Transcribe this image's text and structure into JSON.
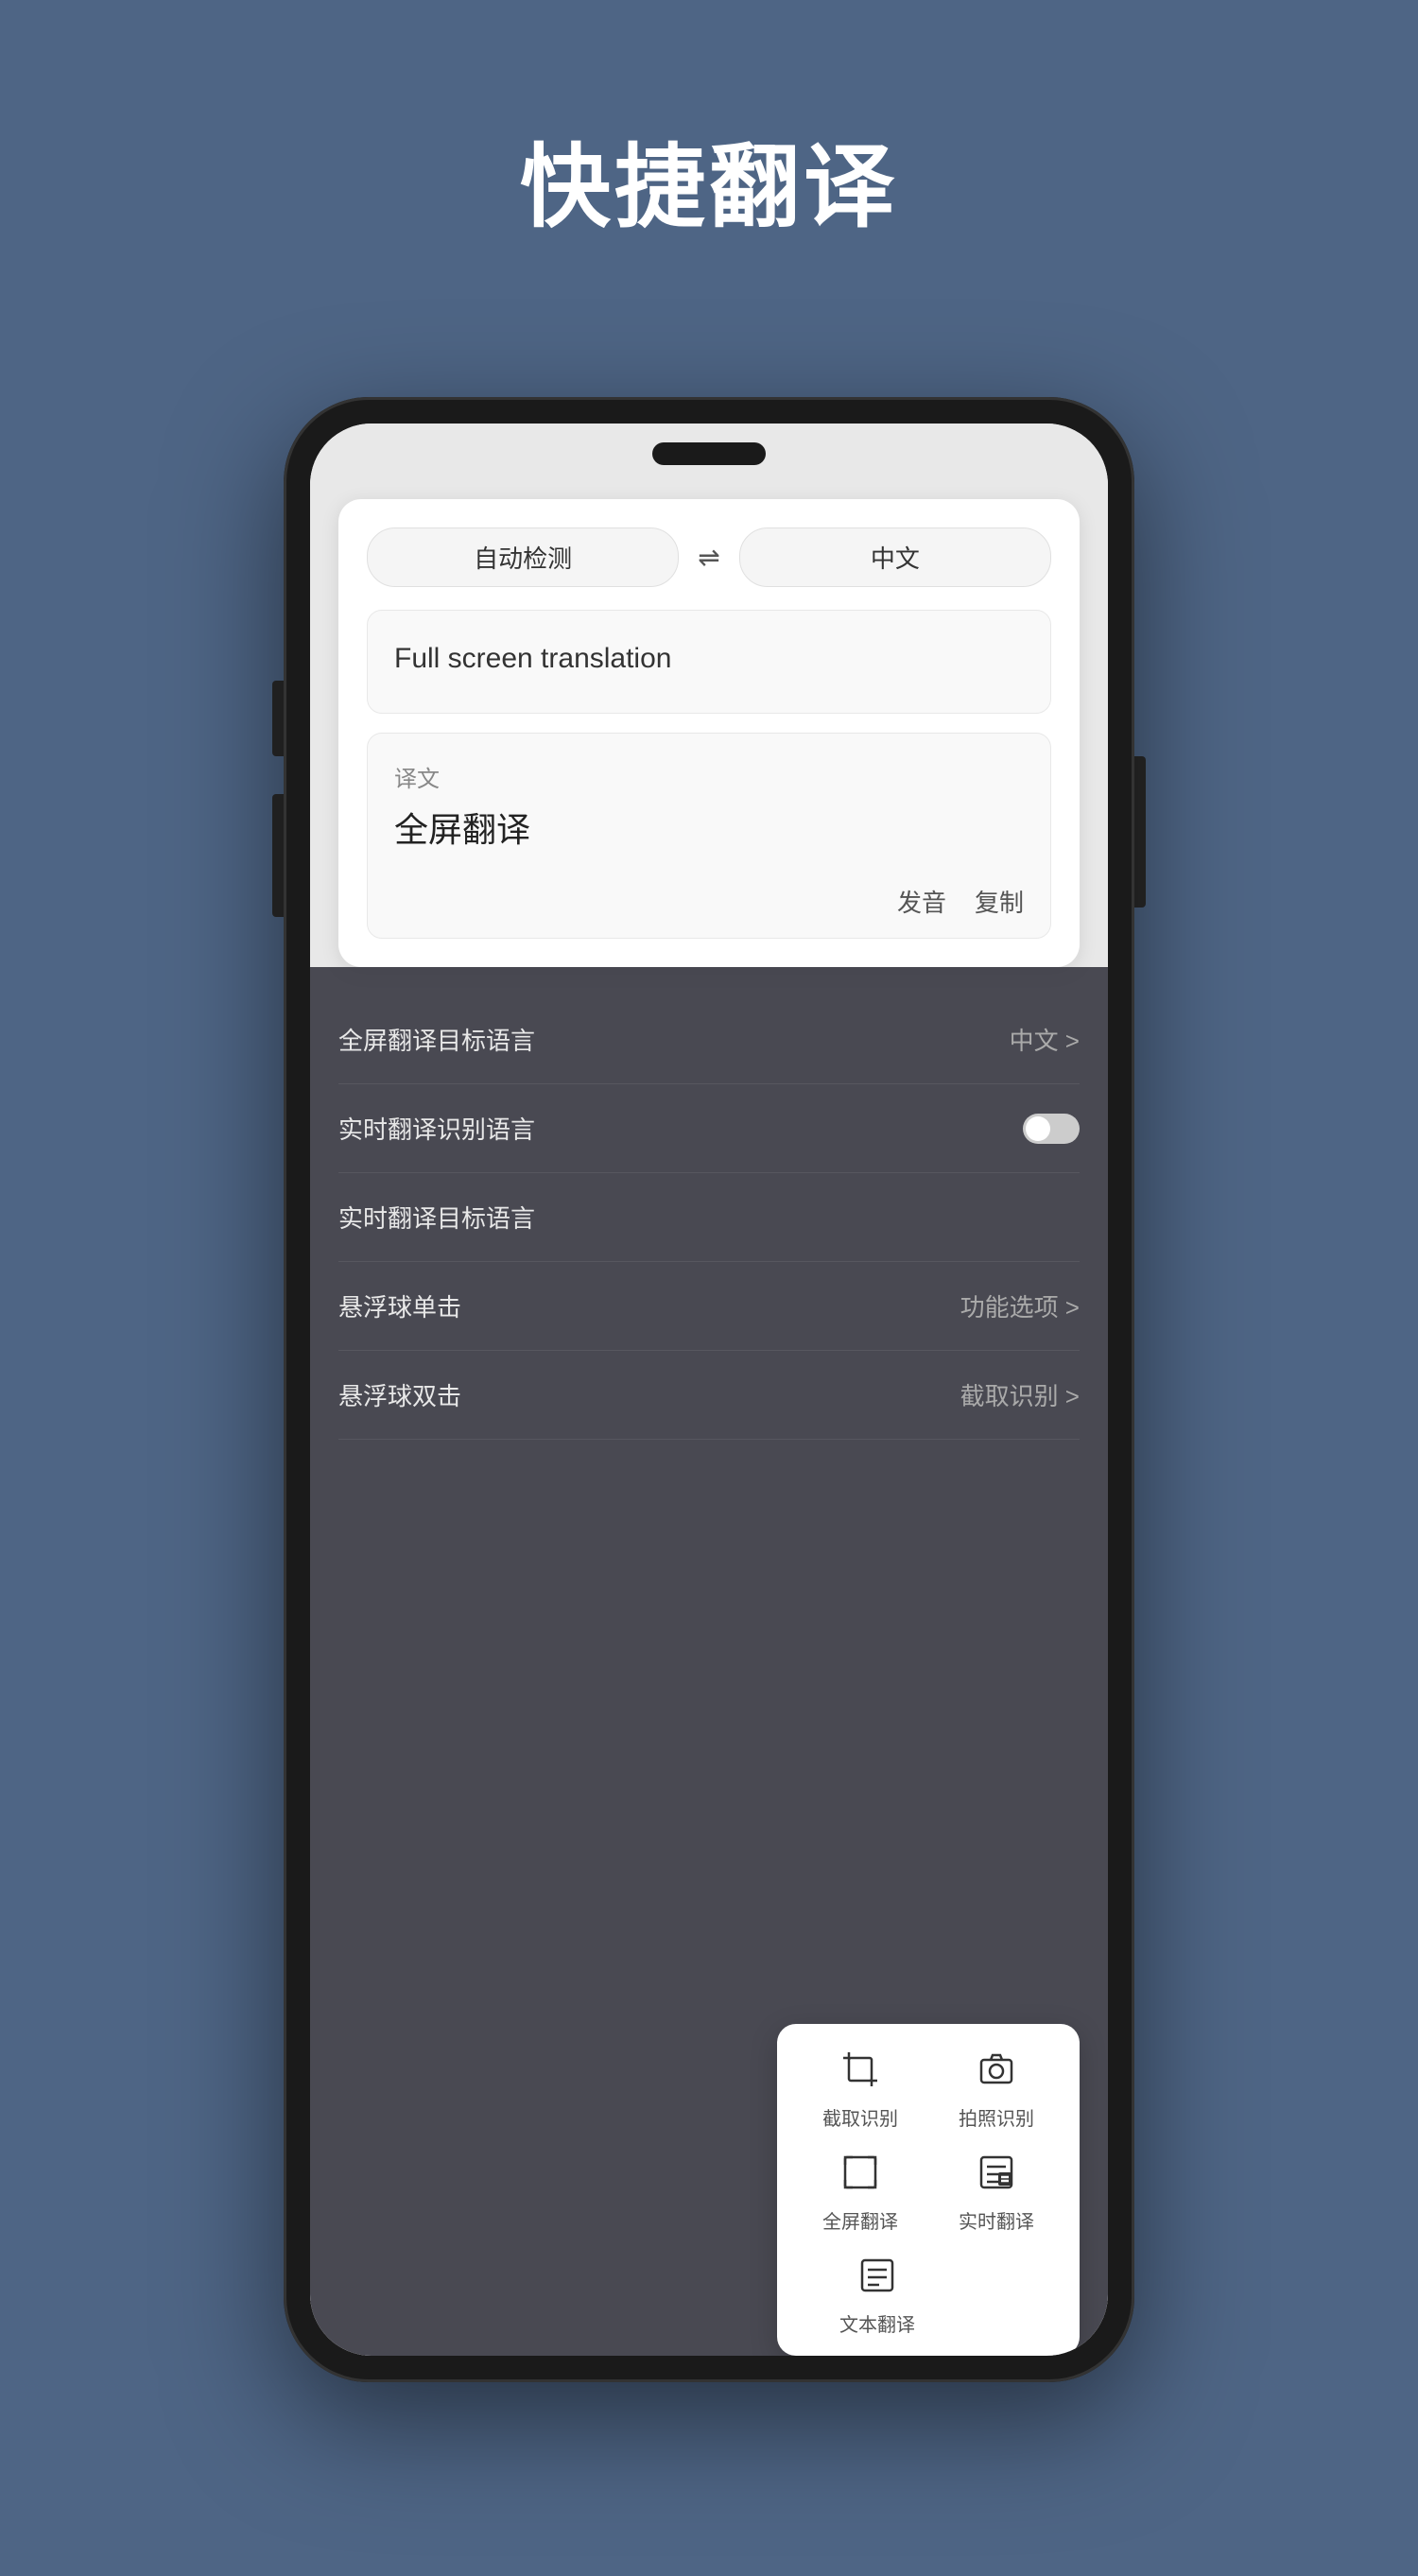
{
  "page": {
    "title": "快捷翻译",
    "background_color": "#4e6585"
  },
  "translator": {
    "source_lang": "自动检测",
    "swap_icon": "⇌",
    "target_lang": "中文",
    "source_text": "Full screen translation",
    "result_label": "译文",
    "result_text": "全屏翻译",
    "action_pronounce": "发音",
    "action_copy": "复制"
  },
  "settings": {
    "items": [
      {
        "label": "全屏翻译目标语言",
        "value": "中文 >"
      },
      {
        "label": "实时翻译识别语言",
        "value": ""
      },
      {
        "label": "实时翻译目标语言",
        "value": ""
      },
      {
        "label": "悬浮球单击",
        "value": "功能选项 >"
      },
      {
        "label": "悬浮球双击",
        "value": "截取识别 >"
      }
    ]
  },
  "floating_menu": {
    "items": [
      [
        {
          "icon": "✂",
          "label": "截取识别"
        },
        {
          "icon": "📷",
          "label": "拍照识别"
        }
      ],
      [
        {
          "icon": "⬚",
          "label": "全屏翻译"
        },
        {
          "icon": "⊟",
          "label": "实时翻译"
        }
      ],
      [
        {
          "icon": "≡",
          "label": "文本翻译"
        }
      ]
    ]
  }
}
